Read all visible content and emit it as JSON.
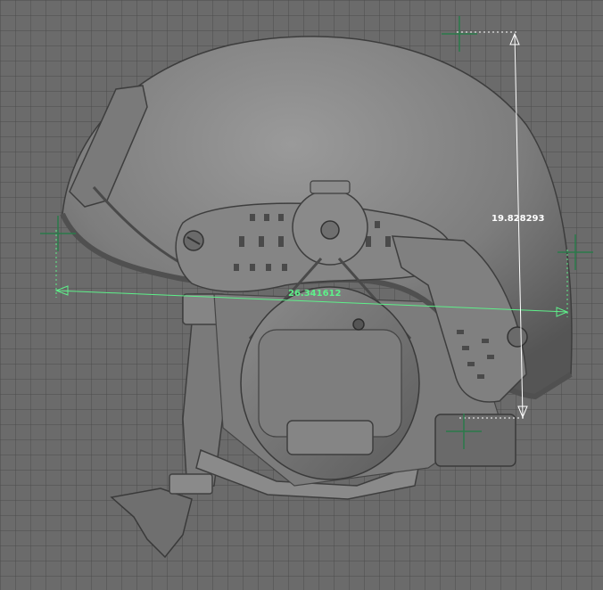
{
  "viewport": {
    "background": "#6e6e6e",
    "grid_color": "#4a4a4a",
    "model": "helmet"
  },
  "measurements": {
    "width_label": "26.341612",
    "height_label": "19.828293",
    "width_color": "#5ef08a",
    "height_color": "#ffffff"
  }
}
